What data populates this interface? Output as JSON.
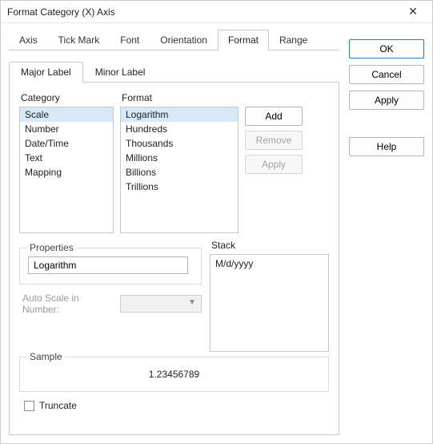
{
  "window": {
    "title": "Format Category (X) Axis"
  },
  "buttons": {
    "ok": "OK",
    "cancel": "Cancel",
    "apply": "Apply",
    "help": "Help"
  },
  "tabs": [
    "Axis",
    "Tick Mark",
    "Font",
    "Orientation",
    "Format",
    "Range"
  ],
  "activeTab": "Format",
  "subtabs": [
    "Major Label",
    "Minor Label"
  ],
  "activeSubtab": "Major Label",
  "category": {
    "label": "Category",
    "items": [
      "Scale",
      "Number",
      "Date/Time",
      "Text",
      "Mapping"
    ],
    "selected": "Scale"
  },
  "format": {
    "label": "Format",
    "items": [
      "Logarithm",
      "Hundreds",
      "Thousands",
      "Millions",
      "Billions",
      "Trillions"
    ],
    "selected": "Logarithm"
  },
  "listButtons": {
    "add": "Add",
    "remove": "Remove",
    "apply": "Apply"
  },
  "properties": {
    "label": "Properties",
    "value": "Logarithm"
  },
  "stack": {
    "label": "Stack",
    "value": "M/d/yyyy"
  },
  "autoscale": {
    "label": "Auto Scale in Number:"
  },
  "sample": {
    "label": "Sample",
    "value": "1.23456789"
  },
  "truncate": {
    "label": "Truncate",
    "checked": false
  }
}
